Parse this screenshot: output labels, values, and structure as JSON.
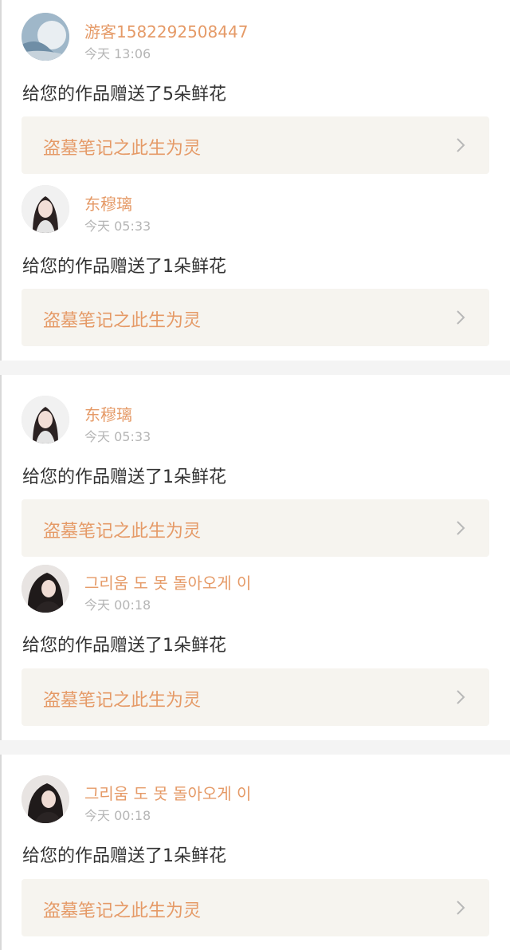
{
  "entries": [
    {
      "name": "游客1582292508447",
      "time": "今天 13:06",
      "message": "给您的作品赠送了5朵鲜花",
      "work": "盗墓笔记之此生为灵",
      "avatar": "moon-avatar"
    },
    {
      "name": "东穆璃",
      "time": "今天 05:33",
      "message": "给您的作品赠送了1朵鲜花",
      "work": "盗墓笔记之此生为灵",
      "avatar": "girl-avatar"
    },
    {
      "name": "东穆璃",
      "time": "今天 05:33",
      "message": "给您的作品赠送了1朵鲜花",
      "work": "盗墓笔记之此生为灵",
      "avatar": "girl-avatar"
    },
    {
      "name": "그리움 도 못 돌아오게 이",
      "time": "今天 00:18",
      "message": "给您的作品赠送了1朵鲜花",
      "work": "盗墓笔记之此生为灵",
      "avatar": "dark-hair-avatar"
    },
    {
      "name": "그리움 도 못 돌아오게 이",
      "time": "今天 00:18",
      "message": "给您的作品赠送了1朵鲜花",
      "work": "盗墓笔记之此生为灵",
      "avatar": "dark-hair-avatar"
    }
  ],
  "colors": {
    "accent": "#e59a67",
    "card_bg": "#f6f4ef",
    "divider": "#f4f4f4",
    "text": "#333333",
    "muted": "#b5b5b5"
  }
}
